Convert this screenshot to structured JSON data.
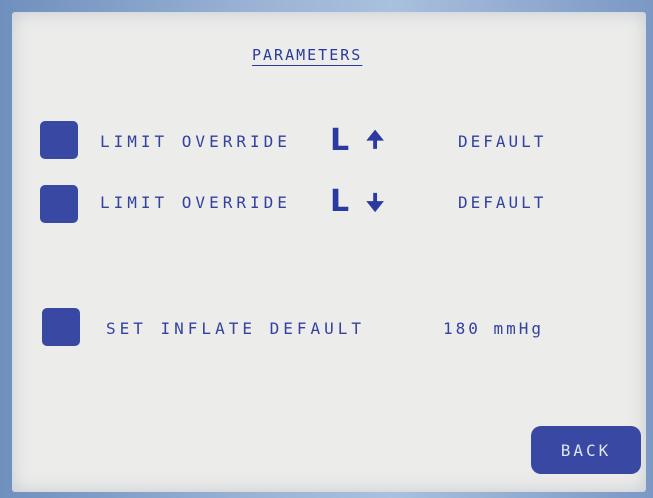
{
  "screen": {
    "title": "PARAMETERS"
  },
  "rows": [
    {
      "label": "LIMIT OVERRIDE",
      "limit_symbol": "L",
      "arrow_icon": "arrow-up-icon",
      "arrow_glyph": "🠉",
      "value": "DEFAULT"
    },
    {
      "label": "LIMIT OVERRIDE",
      "limit_symbol": "L",
      "arrow_icon": "arrow-down-icon",
      "arrow_glyph": "🠋",
      "value": "DEFAULT"
    },
    {
      "label": "SET INFLATE DEFAULT",
      "value": "180 mmHg"
    }
  ],
  "footer": {
    "back_label": "BACK"
  },
  "colors": {
    "accent": "#3948a2",
    "text": "#3341a0",
    "screen_bg": "#ececea"
  }
}
